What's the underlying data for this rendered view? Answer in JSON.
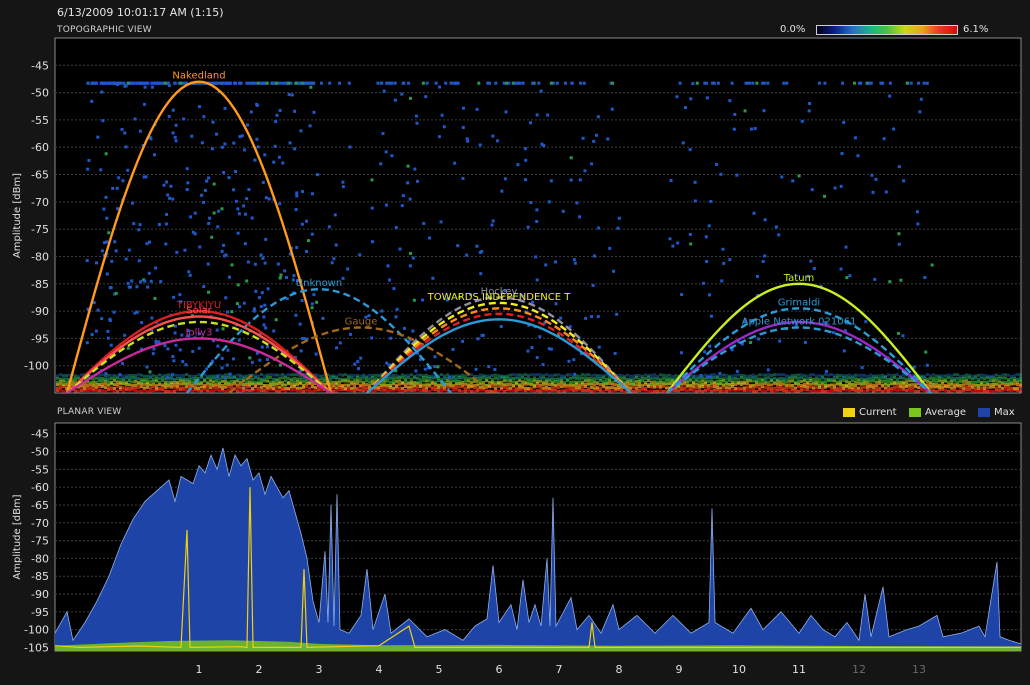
{
  "timestamp": "6/13/2009 10:01:17 AM (1:15)",
  "topo": {
    "title": "TOPOGRAPHIC VIEW",
    "scale_min_label": "0.0%",
    "scale_max_label": "6.1%"
  },
  "planar": {
    "title": "PLANAR VIEW",
    "legend": [
      {
        "label": "Current",
        "color": "#f0d010"
      },
      {
        "label": "Average",
        "color": "#7ac41c"
      },
      {
        "label": "Max",
        "color": "#1e44a8"
      }
    ]
  },
  "chart_data": [
    {
      "type": "line",
      "name": "topographic",
      "title": "TOPOGRAPHIC VIEW",
      "xlabel": "",
      "ylabel": "Amplitude [dBm]",
      "ylim": [
        -105,
        -40
      ],
      "yticks": [
        -45,
        -50,
        -55,
        -60,
        -65,
        -70,
        -75,
        -80,
        -85,
        -90,
        -95,
        -100
      ],
      "grid": true,
      "networks": [
        {
          "name": "Nakedland",
          "center": 1.0,
          "peak": -48,
          "color": "#ff9a1a",
          "dash": false
        },
        {
          "name": "Unknown",
          "center": 3.0,
          "peak": -86,
          "color": "#2a9ad8",
          "dash": true
        },
        {
          "name": "Gauge",
          "center": 3.7,
          "peak": -93,
          "color": "#a06818",
          "dash": true
        },
        {
          "name": "TIBYKJYU",
          "center": 1.0,
          "peak": -90,
          "color": "#d82020",
          "dash": false
        },
        {
          "name": "Solar",
          "center": 1.0,
          "peak": -91,
          "color": "#ff5050",
          "dash": false
        },
        {
          "name": "",
          "center": 1.0,
          "peak": -92,
          "color": "#c8e020",
          "dash": true
        },
        {
          "name": "Jolly3",
          "center": 1.0,
          "peak": -95,
          "color": "#c82a9a",
          "dash": false
        },
        {
          "name": "Hockey",
          "center": 6.0,
          "peak": -87.5,
          "color": "#9090a0",
          "dash": true
        },
        {
          "name": "TOWARDS INDEPENDENCE T",
          "center": 6.0,
          "peak": -88.5,
          "color": "#f0f020",
          "dash": true
        },
        {
          "name": "",
          "center": 6.0,
          "peak": -89.5,
          "color": "#ff8c1a",
          "dash": true
        },
        {
          "name": "",
          "center": 6.0,
          "peak": -90.5,
          "color": "#e02020",
          "dash": true
        },
        {
          "name": "",
          "center": 6.0,
          "peak": -91.5,
          "color": "#2a9ad8",
          "dash": false
        },
        {
          "name": "Tatum",
          "center": 11.0,
          "peak": -85,
          "color": "#c8f020",
          "dash": false
        },
        {
          "name": "Grimaldi",
          "center": 11.0,
          "peak": -89.5,
          "color": "#2a9ad8",
          "dash": true
        },
        {
          "name": "",
          "center": 11.0,
          "peak": -92,
          "color": "#9a2ac8",
          "dash": false
        },
        {
          "name": "Apple Network 021061",
          "center": 11.0,
          "peak": -93,
          "color": "#2a9ad8",
          "dash": true
        }
      ]
    },
    {
      "type": "area",
      "name": "planar",
      "title": "PLANAR VIEW",
      "xlabel": "",
      "ylabel": "Amplitude [dBm]",
      "ylim": [
        -106,
        -42
      ],
      "yticks": [
        -45,
        -50,
        -55,
        -60,
        -65,
        -70,
        -75,
        -80,
        -85,
        -90,
        -95,
        -100,
        -105
      ],
      "x_ticks": [
        {
          "label": "1",
          "value": 1,
          "dim": false
        },
        {
          "label": "2",
          "value": 2,
          "dim": false
        },
        {
          "label": "3",
          "value": 3,
          "dim": false
        },
        {
          "label": "4",
          "value": 4,
          "dim": false
        },
        {
          "label": "5",
          "value": 5,
          "dim": false
        },
        {
          "label": "6",
          "value": 6,
          "dim": false
        },
        {
          "label": "7",
          "value": 7,
          "dim": false
        },
        {
          "label": "8",
          "value": 8,
          "dim": false
        },
        {
          "label": "9",
          "value": 9,
          "dim": false
        },
        {
          "label": "10",
          "value": 10,
          "dim": false
        },
        {
          "label": "11",
          "value": 11,
          "dim": false
        },
        {
          "label": "12",
          "value": 12,
          "dim": true
        },
        {
          "label": "13",
          "value": 13,
          "dim": true
        }
      ],
      "xlim": [
        -1.4,
        14.7
      ],
      "grid": true,
      "legend_position": "top-right",
      "series": [
        {
          "name": "Max",
          "color": "#1e44a8",
          "points": [
            [
              -1.4,
              -101
            ],
            [
              -1.2,
              -95
            ],
            [
              -1.1,
              -103
            ],
            [
              -0.9,
              -98
            ],
            [
              -0.7,
              -92
            ],
            [
              -0.5,
              -85
            ],
            [
              -0.3,
              -76
            ],
            [
              -0.1,
              -69
            ],
            [
              0.1,
              -64
            ],
            [
              0.3,
              -61
            ],
            [
              0.5,
              -58
            ],
            [
              0.6,
              -64
            ],
            [
              0.7,
              -57
            ],
            [
              0.9,
              -59
            ],
            [
              1.0,
              -54
            ],
            [
              1.1,
              -56
            ],
            [
              1.2,
              -51
            ],
            [
              1.3,
              -55
            ],
            [
              1.4,
              -49
            ],
            [
              1.5,
              -57
            ],
            [
              1.6,
              -51
            ],
            [
              1.7,
              -54
            ],
            [
              1.8,
              -52
            ],
            [
              1.9,
              -58
            ],
            [
              2.0,
              -56
            ],
            [
              2.1,
              -62
            ],
            [
              2.2,
              -57
            ],
            [
              2.3,
              -60
            ],
            [
              2.4,
              -63
            ],
            [
              2.5,
              -61
            ],
            [
              2.6,
              -67
            ],
            [
              2.7,
              -73
            ],
            [
              2.8,
              -80
            ],
            [
              2.9,
              -92
            ],
            [
              3.0,
              -98
            ],
            [
              3.1,
              -78
            ],
            [
              3.15,
              -98
            ],
            [
              3.2,
              -65
            ],
            [
              3.25,
              -99
            ],
            [
              3.3,
              -62
            ],
            [
              3.35,
              -100
            ],
            [
              3.5,
              -101
            ],
            [
              3.7,
              -96
            ],
            [
              3.8,
              -83
            ],
            [
              3.9,
              -100
            ],
            [
              4.1,
              -90
            ],
            [
              4.2,
              -101
            ],
            [
              4.5,
              -97
            ],
            [
              4.8,
              -102
            ],
            [
              5.1,
              -100
            ],
            [
              5.4,
              -103
            ],
            [
              5.6,
              -99
            ],
            [
              5.8,
              -97
            ],
            [
              5.9,
              -82
            ],
            [
              6.0,
              -98
            ],
            [
              6.2,
              -93
            ],
            [
              6.3,
              -100
            ],
            [
              6.4,
              -86
            ],
            [
              6.5,
              -98
            ],
            [
              6.6,
              -93
            ],
            [
              6.7,
              -99
            ],
            [
              6.8,
              -80
            ],
            [
              6.85,
              -99
            ],
            [
              6.9,
              -63
            ],
            [
              6.95,
              -99
            ],
            [
              7.2,
              -91
            ],
            [
              7.3,
              -100
            ],
            [
              7.5,
              -96
            ],
            [
              7.7,
              -101
            ],
            [
              7.9,
              -93
            ],
            [
              8.0,
              -100
            ],
            [
              8.3,
              -96
            ],
            [
              8.6,
              -101
            ],
            [
              8.9,
              -96
            ],
            [
              9.2,
              -101
            ],
            [
              9.5,
              -98
            ],
            [
              9.55,
              -66
            ],
            [
              9.6,
              -98
            ],
            [
              9.9,
              -101
            ],
            [
              10.2,
              -94
            ],
            [
              10.4,
              -100
            ],
            [
              10.7,
              -95
            ],
            [
              11.0,
              -101
            ],
            [
              11.2,
              -96
            ],
            [
              11.4,
              -100
            ],
            [
              11.6,
              -102
            ],
            [
              11.8,
              -98
            ],
            [
              12.0,
              -103
            ],
            [
              12.1,
              -90
            ],
            [
              12.2,
              -102
            ],
            [
              12.4,
              -88
            ],
            [
              12.5,
              -102
            ],
            [
              12.8,
              -100
            ],
            [
              13.0,
              -99
            ],
            [
              13.3,
              -96
            ],
            [
              13.4,
              -102
            ],
            [
              13.7,
              -101
            ],
            [
              14.0,
              -99
            ],
            [
              14.1,
              -102
            ],
            [
              14.3,
              -81
            ],
            [
              14.35,
              -102
            ],
            [
              14.5,
              -103
            ],
            [
              14.7,
              -104
            ]
          ]
        },
        {
          "name": "Average",
          "color": "#7ac41c",
          "points": [
            [
              -1.4,
              -104.5
            ],
            [
              -0.5,
              -103.8
            ],
            [
              0.5,
              -103.2
            ],
            [
              1.5,
              -103
            ],
            [
              2.5,
              -103.4
            ],
            [
              3.0,
              -104
            ],
            [
              4.0,
              -104.4
            ],
            [
              6.0,
              -104.3
            ],
            [
              8.0,
              -104.5
            ],
            [
              10.0,
              -104.4
            ],
            [
              12.0,
              -104.6
            ],
            [
              14.7,
              -104.7
            ]
          ]
        },
        {
          "name": "Current",
          "color": "#f0d010",
          "points": [
            [
              -1.4,
              -104.5
            ],
            [
              -1.0,
              -105
            ],
            [
              0.0,
              -104.6
            ],
            [
              0.7,
              -105
            ],
            [
              0.8,
              -72
            ],
            [
              0.85,
              -105
            ],
            [
              1.7,
              -104.8
            ],
            [
              1.8,
              -105
            ],
            [
              1.85,
              -60
            ],
            [
              1.9,
              -105
            ],
            [
              2.7,
              -105
            ],
            [
              2.75,
              -83
            ],
            [
              2.8,
              -105
            ],
            [
              4.0,
              -104.5
            ],
            [
              4.5,
              -99
            ],
            [
              4.6,
              -105
            ],
            [
              7.5,
              -105
            ],
            [
              7.55,
              -98
            ],
            [
              7.6,
              -105
            ],
            [
              14.7,
              -105
            ]
          ]
        }
      ]
    }
  ]
}
